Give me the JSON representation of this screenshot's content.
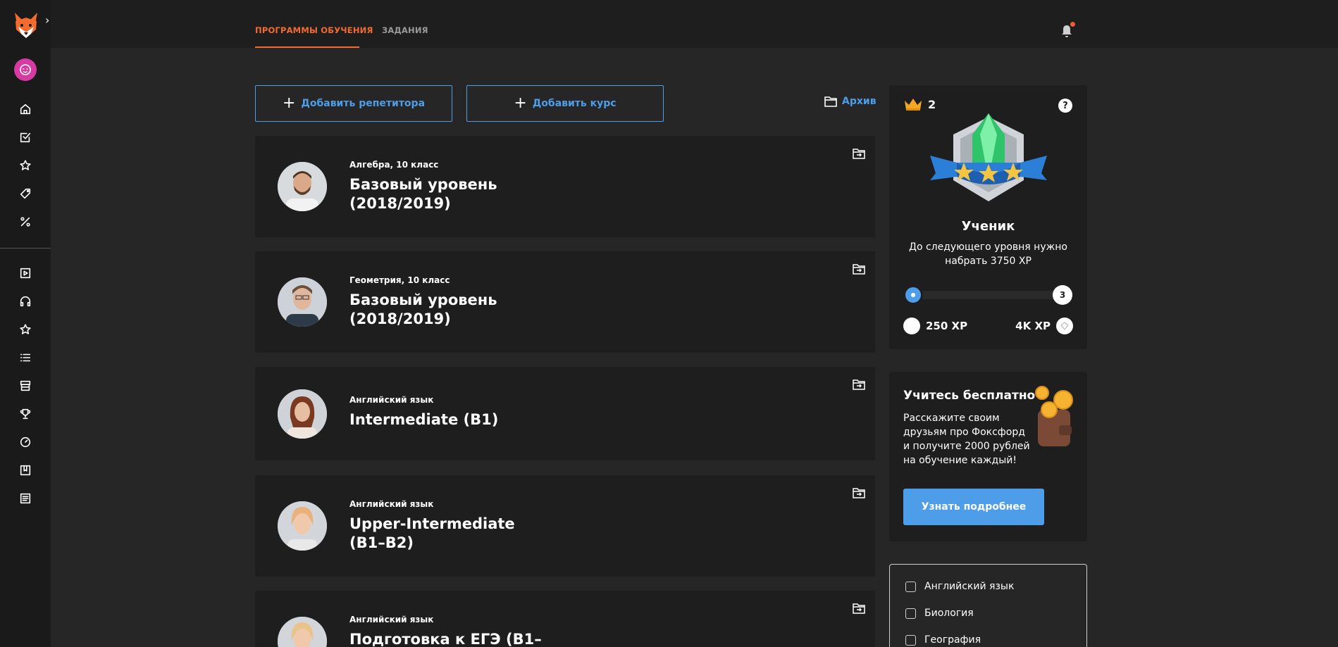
{
  "topbar": {
    "tabs": [
      {
        "label": "ПРОГРАММЫ ОБУЧЕНИЯ",
        "active": true
      },
      {
        "label": "ЗАДАНИЯ",
        "active": false
      }
    ],
    "accent_color": "#f26b2f"
  },
  "sidebar": {
    "top_icons": [
      "home-icon",
      "checkbox-icon",
      "star-icon",
      "tag-icon",
      "percent-icon"
    ],
    "bottom_icons": [
      "play-icon",
      "headphones-icon",
      "star-outline-icon",
      "list-icon",
      "store-icon",
      "trophy-icon",
      "clock-icon",
      "book-icon",
      "document-icon"
    ]
  },
  "actions": {
    "add_tutor": "Добавить репетитора",
    "add_course": "Добавить курс",
    "archive": "Архив"
  },
  "courses": [
    {
      "subject": "Алгебра, 10 класс",
      "title": "Базовый уровень (2018/2019)"
    },
    {
      "subject": "Геометрия, 10 класс",
      "title": "Базовый уровень (2018/2019)"
    },
    {
      "subject": "Английский язык",
      "title": "Intermediate (B1)"
    },
    {
      "subject": "Английский язык",
      "title": "Upper-Intermediate (B1–B2)"
    },
    {
      "subject": "Английский язык",
      "title": "Подготовка к ЕГЭ (B1–"
    }
  ],
  "level": {
    "crowns": "2",
    "rank": "Ученик",
    "description": "До следующего уровня нужно набрать 3750 XP",
    "next_level": "3",
    "progress": 0,
    "xp_current": "250 XP",
    "xp_target": "4K XP"
  },
  "promo": {
    "title": "Учитесь бесплатно",
    "text": "Расскажите своим друзьям про Фоксфорд и получите 2000 рублей на обучение каждый!",
    "button": "Узнать подробнее"
  },
  "filters": [
    "Английский язык",
    "Биология",
    "География"
  ],
  "colors": {
    "link": "#4d9de8",
    "notification": "#f05a3a"
  }
}
